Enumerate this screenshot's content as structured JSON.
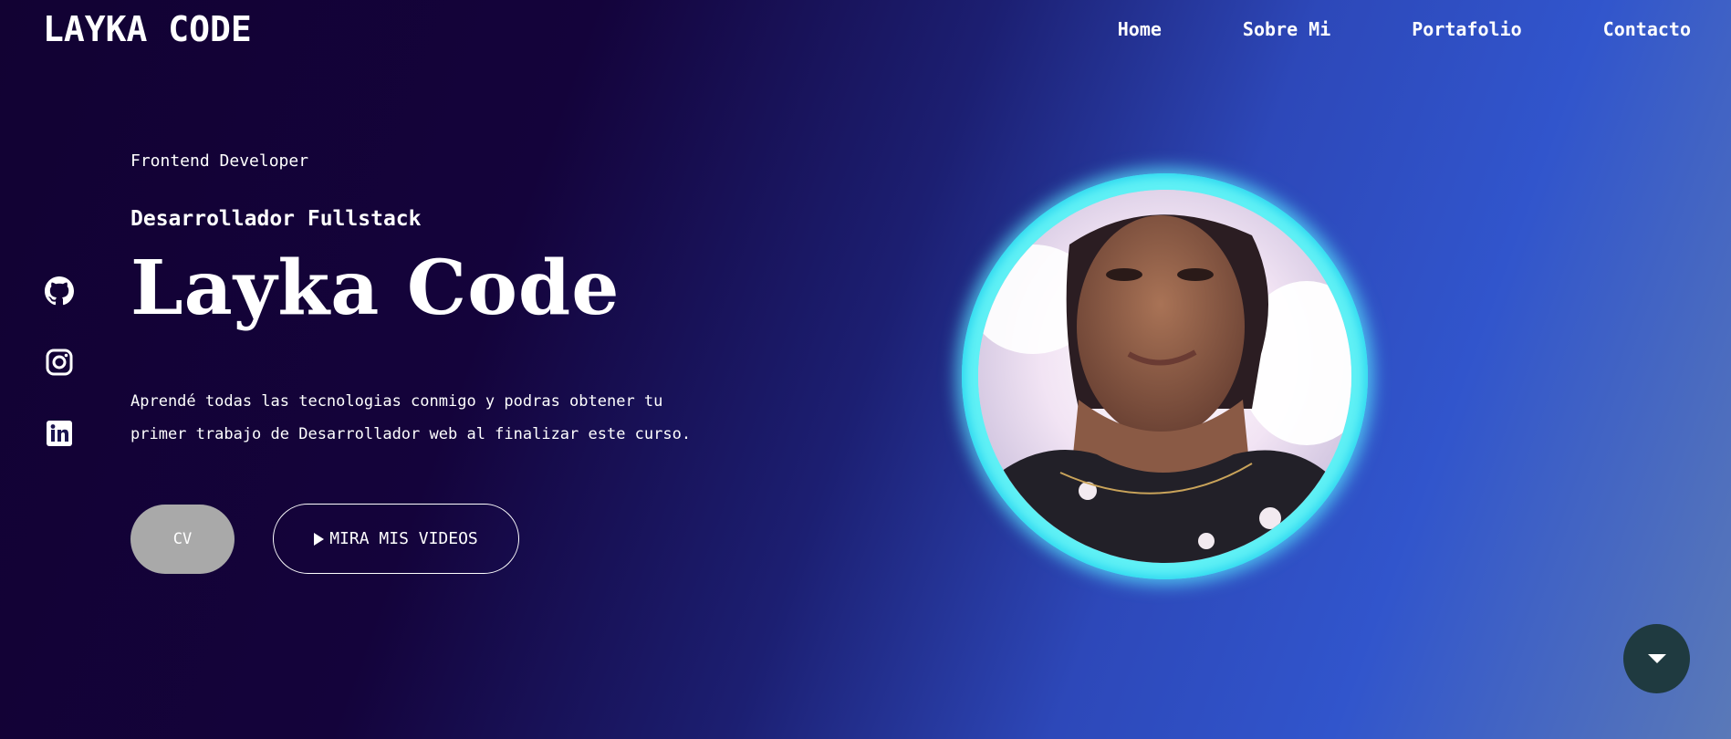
{
  "brand": {
    "logo": "LAYKA CODE"
  },
  "nav": {
    "items": [
      "Home",
      "Sobre Mi",
      "Portafolio",
      "Contacto"
    ]
  },
  "social": {
    "icons": [
      "github-icon",
      "instagram-icon",
      "linkedin-icon"
    ]
  },
  "hero": {
    "role": "Frontend Developer",
    "subtitle": "Desarrollador Fullstack",
    "headline": "Layka Code",
    "description_line1": "Aprendé todas las tecnologias conmigo y podras obtener tu",
    "description_line2": "primer trabajo de Desarrollador web al finalizar este curso.",
    "cv_button": "CV",
    "videos_button": "MIRA MIS VIDEOS"
  },
  "colors": {
    "background_start": "#120233",
    "background_end": "#3155cc",
    "avatar_ring": "#5ff0f5",
    "cv_button_bg": "#a9a9a9",
    "scroll_button_bg": "#1f3a40"
  },
  "icons": {
    "scroll": "chevron-down-icon",
    "play": "play-icon"
  }
}
